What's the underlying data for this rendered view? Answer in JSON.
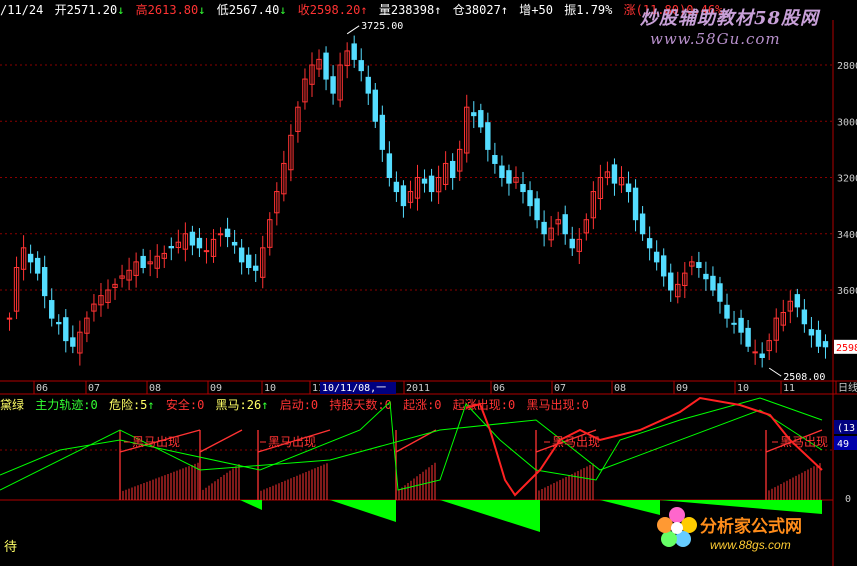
{
  "header": {
    "date": "/11/24",
    "open_label": "开",
    "open": "2571.20",
    "open_arrow": "↓",
    "high_label": "高",
    "high": "2613.80",
    "high_arrow": "↓",
    "low_label": "低",
    "low": "2567.40",
    "low_arrow": "↓",
    "close_label": "收",
    "close": "2598.20",
    "close_arrow": "↑",
    "volume_label": "量",
    "volume": "238398",
    "volume_arrow": "↑",
    "position_label": "仓",
    "position": "38027",
    "position_arrow": "↑",
    "increase_label": "增",
    "increase": "+50",
    "amplitude_label": "振",
    "amplitude": "1.79%",
    "change_label": "涨",
    "change": "(11.80)",
    "change_pct": "0.46%"
  },
  "watermark_top": {
    "title": "炒股辅助教材58股网",
    "url": "www.58Gu.com"
  },
  "watermark_bottom": {
    "title": "分析家公式网",
    "url": "www.88gs.com"
  },
  "indicator_bar": {
    "title": "黛绿",
    "items": [
      {
        "label": "主力轨迹:0",
        "color": "#33ff33"
      },
      {
        "label": "危险:5",
        "color": "#ffff66",
        "arrow": "↑"
      },
      {
        "label": "安全:0",
        "color": "#ff3333"
      },
      {
        "label": "黑马:26",
        "color": "#ffff66",
        "arrow": "↑"
      },
      {
        "label": "启动:0",
        "color": "#ff3333"
      },
      {
        "label": "持股天数:0",
        "color": "#ff3333"
      },
      {
        "label": "起涨:0",
        "color": "#ff3333"
      },
      {
        "label": "起涨出现:0",
        "color": "#ff3333"
      },
      {
        "label": "黑马出现:0",
        "color": "#ff3333"
      }
    ]
  },
  "status_text": "待",
  "annotations": {
    "max_label": "3725.00",
    "min_label": "2508.00",
    "signal_label": "黑马出现"
  },
  "x_axis": {
    "labels": [
      "06",
      "07",
      "08",
      "09",
      "10",
      "11",
      "2011",
      "06",
      "07",
      "08",
      "09",
      "10",
      "11",
      "日线"
    ],
    "cursor_label": "10/11/08,一"
  },
  "y_axis_labels": [
    "3600",
    "3400",
    "3200",
    "3000",
    "2800",
    "2598"
  ],
  "indicator_axis_labels": [
    "(13",
    "49",
    "0"
  ],
  "colors": {
    "up": "#ff3333",
    "down": "#55ddff",
    "axis": "#b00000",
    "green": "#00ff00",
    "yellow": "#ffff00",
    "grid": "#8a0000"
  },
  "chart_data": [
    {
      "type": "line",
      "title": "",
      "description_series": "Daily candlestick closes (approx.)",
      "y_axis": {
        "ticks": [
          2800,
          3000,
          3200,
          3400,
          3600
        ],
        "range": [
          2480,
          3760
        ]
      },
      "series": [
        {
          "values": [
            2700,
            2880,
            2950,
            2900,
            2860,
            2780,
            2700,
            2680,
            2620,
            2600,
            2650,
            2700,
            2750,
            2780,
            2800,
            2820,
            2850,
            2870,
            2900,
            2880,
            2900,
            2920,
            2930,
            2950,
            2970,
            3000,
            2960,
            2950,
            2940,
            2980,
            3000,
            2990,
            2960,
            2900,
            2880,
            2870,
            2950,
            3050,
            3150,
            3250,
            3350,
            3450,
            3550,
            3600,
            3620,
            3550,
            3500,
            3600,
            3650,
            3620,
            3580,
            3500,
            3400,
            3300,
            3200,
            3150,
            3100,
            3150,
            3200,
            3180,
            3150,
            3200,
            3250,
            3200,
            3300,
            3450,
            3420,
            3380,
            3300,
            3250,
            3200,
            3180,
            3200,
            3150,
            3100,
            3050,
            3000,
            3020,
            3050,
            3000,
            2950,
            2980,
            3050,
            3150,
            3200,
            3220,
            3180,
            3200,
            3150,
            3050,
            3000,
            2950,
            2900,
            2850,
            2800,
            2820,
            2860,
            2900,
            2880,
            2840,
            2800,
            2760,
            2700,
            2680,
            2650,
            2600,
            2580,
            2560,
            2620,
            2700,
            2720,
            2760,
            2740,
            2680,
            2640,
            2600,
            2598
          ]
        }
      ],
      "annotations": [
        {
          "label": "3725.00",
          "x": 48,
          "y": 3725
        },
        {
          "label": "2508.00",
          "x": 108,
          "y": 2508
        }
      ]
    }
  ]
}
